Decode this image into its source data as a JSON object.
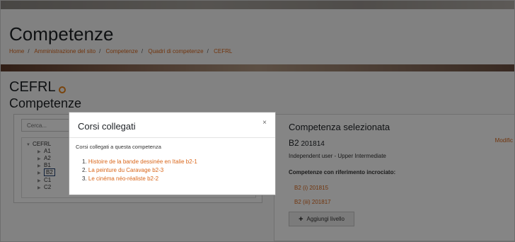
{
  "page": {
    "title": "Competenze",
    "breadcrumb": [
      "Home",
      "Amministrazione del sito",
      "Competenze",
      "Quadri di competenze",
      "CEFRL"
    ]
  },
  "framework": {
    "name": "CEFRL",
    "section": "Competenze",
    "search_placeholder": "Cerca...",
    "tree": {
      "root": "CEFRL",
      "items": [
        "A1",
        "A2",
        "B1",
        "B2",
        "C1",
        "C2"
      ],
      "selected": "B2"
    }
  },
  "detail": {
    "heading": "Competenza selezionata",
    "name": "B2",
    "idnumber": "201814",
    "edit_label": "Modific",
    "description": "Independent user - Upper Intermediate",
    "cross_heading": "Competenze con riferimento incrociato:",
    "cross_refs": [
      "B2 (i) 201815",
      "B2 (iii) 201817"
    ],
    "add_level_label": "Aggiungi livello"
  },
  "modal": {
    "title": "Corsi collegati",
    "close_glyph": "×",
    "body_text": "Corsi collegati a questa competenza",
    "courses": [
      {
        "num": "1.",
        "name": "Histoire de la bande dessinée en Italie b2-1"
      },
      {
        "num": "2.",
        "name": "La peinture du Caravage b2-3"
      },
      {
        "num": "3.",
        "name": "Le cinéma néo-réaliste b2-2"
      }
    ]
  },
  "colors": {
    "link": "#d9661a",
    "text": "#1d2125",
    "selected_border": "#1f3f70"
  }
}
